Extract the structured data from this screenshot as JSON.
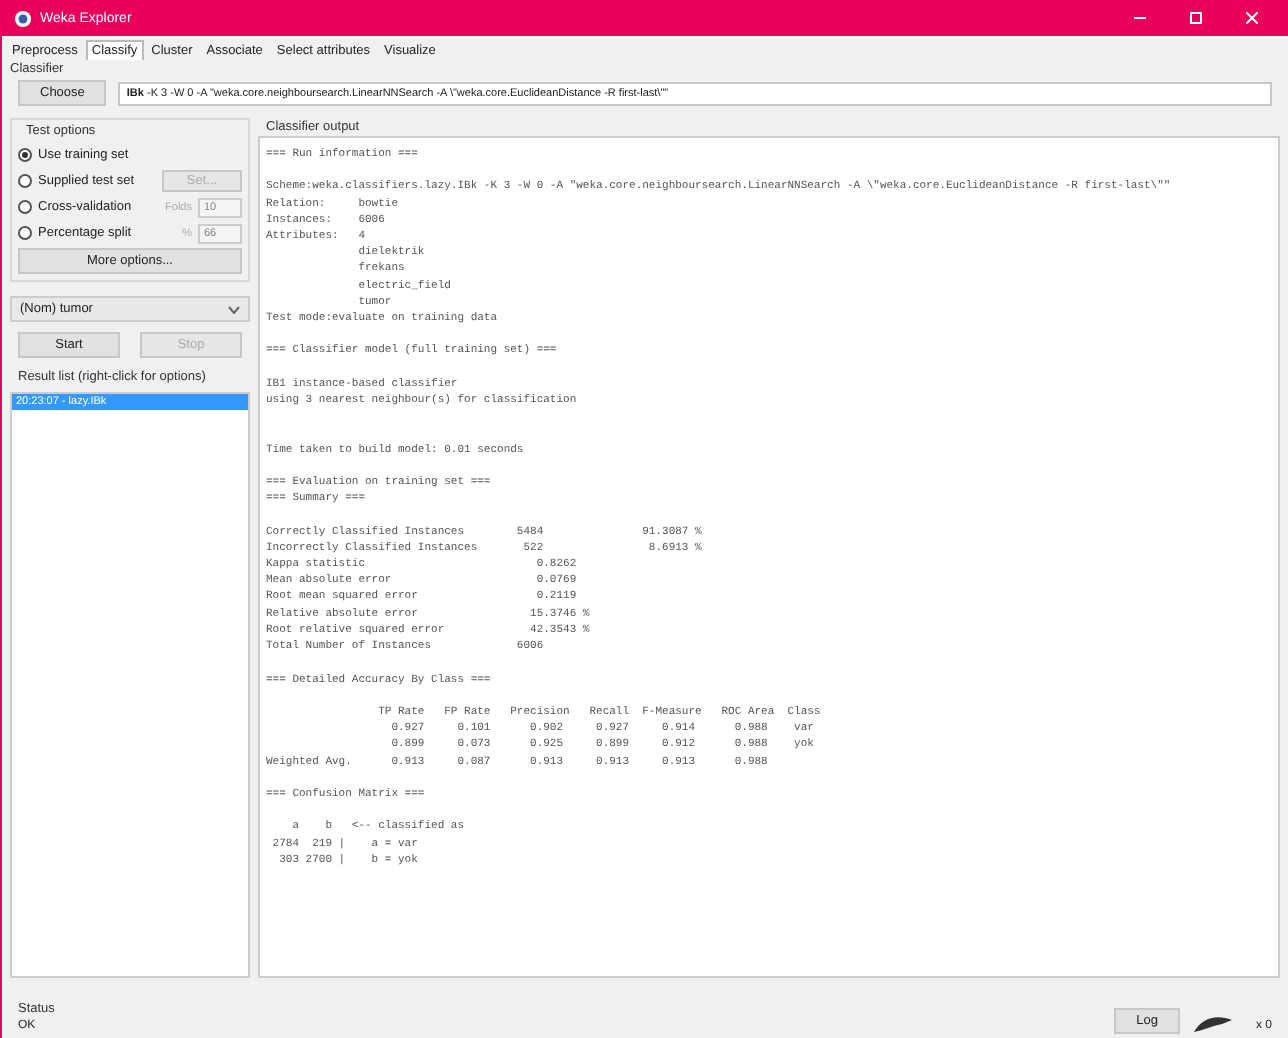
{
  "window": {
    "title": "Weka Explorer"
  },
  "tabs": [
    {
      "label": "Preprocess",
      "selected": false
    },
    {
      "label": "Classify",
      "selected": true
    },
    {
      "label": "Cluster",
      "selected": false
    },
    {
      "label": "Associate",
      "selected": false
    },
    {
      "label": "Select attributes",
      "selected": false
    },
    {
      "label": "Visualize",
      "selected": false
    }
  ],
  "classifier": {
    "label": "Classifier",
    "button": "Choose",
    "name": "IBk",
    "options": "-K 3 -W 0 -A \"weka.core.neighboursearch.LinearNNSearch -A \\\"weka.core.EuclideanDistance -R first-last\\\"\""
  },
  "test_options": {
    "label": "Test options",
    "options": [
      {
        "label": "Use training set",
        "selected": true
      },
      {
        "label": "Supplied test set",
        "selected": false,
        "button": {
          "label": "Set...",
          "disabled": true
        }
      },
      {
        "label": "Cross-validation",
        "selected": false,
        "field": {
          "label": "Folds",
          "value": "10",
          "disabled": true
        }
      },
      {
        "label": "Percentage split",
        "selected": false,
        "field": {
          "label": "%",
          "value": "66",
          "disabled": true
        }
      }
    ],
    "more_button": "More options..."
  },
  "class_select": {
    "value": "(Nom) tumor"
  },
  "buttons": [
    {
      "label": "Start",
      "disabled": false
    },
    {
      "label": "Stop",
      "disabled": true
    }
  ],
  "result_list": {
    "label": "Result list (right-click for options)",
    "items": [
      {
        "label": "20:23:07 - lazy.IBk",
        "selected": true
      }
    ]
  },
  "output": {
    "label": "Classifier output",
    "text": "=== Run information ===\n\nScheme:weka.classifiers.lazy.IBk -K 3 -W 0 -A \"weka.core.neighboursearch.LinearNNSearch -A \\\"weka.core.EuclideanDistance -R first-last\\\"\"\nRelation:     bowtie\nInstances:    6006\nAttributes:   4\n              dielektrik\n              frekans\n              electric_field\n              tumor\nTest mode:evaluate on training data\n\n=== Classifier model (full training set) ===\n\nIB1 instance-based classifier\nusing 3 nearest neighbour(s) for classification\n\n\nTime taken to build model: 0.01 seconds\n\n=== Evaluation on training set ===\n=== Summary ===\n\nCorrectly Classified Instances        5484               91.3087 %\nIncorrectly Classified Instances       522                8.6913 %\nKappa statistic                          0.8262\nMean absolute error                      0.0769\nRoot mean squared error                  0.2119\nRelative absolute error                 15.3746 %\nRoot relative squared error             42.3543 %\nTotal Number of Instances             6006     \n\n=== Detailed Accuracy By Class ===\n\n                 TP Rate   FP Rate   Precision   Recall  F-Measure   ROC Area  Class\n                   0.927     0.101      0.902     0.927     0.914      0.988    var\n                   0.899     0.073      0.925     0.899     0.912      0.988    yok\nWeighted Avg.      0.913     0.087      0.913     0.913     0.913      0.988\n\n=== Confusion Matrix ===\n\n    a    b   <-- classified as\n 2784  219 |    a = var\n  303 2700 |    b = yok"
  },
  "status": {
    "label": "Status",
    "text": "OK",
    "log_button": "Log",
    "count": "x 0"
  }
}
